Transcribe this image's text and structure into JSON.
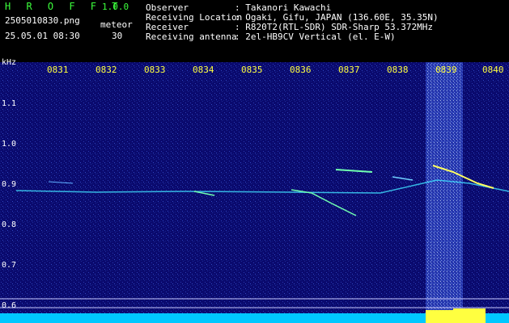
{
  "header": {
    "app_title": "H R O F F T",
    "version": "1.0.0",
    "filename": "2505010830.png",
    "meteor_label": "meteor",
    "datetime": "25.05.01 08:30",
    "meteor_count": "30",
    "info": [
      {
        "label": "Observer",
        "value": ": Takanori Kawachi"
      },
      {
        "label": "Receiving Location",
        "value": ": Ogaki, Gifu, JAPAN (136.60E, 35.35N)"
      },
      {
        "label": "Receiver",
        "value": ": R820T2(RTL-SDR) SDR-Sharp 53.372MHz"
      },
      {
        "label": "Receiving antenna",
        "value": ": 2el-HB9CV Vertical (el. E-W)"
      }
    ]
  },
  "axis": {
    "unit": "kHz",
    "y_labels": [
      "1.1",
      "1.0",
      "0.9",
      "0.8",
      "0.7",
      "0.6"
    ],
    "x_labels": [
      "0831",
      "0832",
      "0833",
      "0834",
      "0835",
      "0836",
      "0837",
      "0838",
      "0839",
      "0840"
    ]
  },
  "colors": {
    "background": "#0a0a6e",
    "header_text_green": "#3cff3c",
    "header_text_white": "#ffffff",
    "time_labels": "#ffff40",
    "trace": "#40e0ff"
  }
}
